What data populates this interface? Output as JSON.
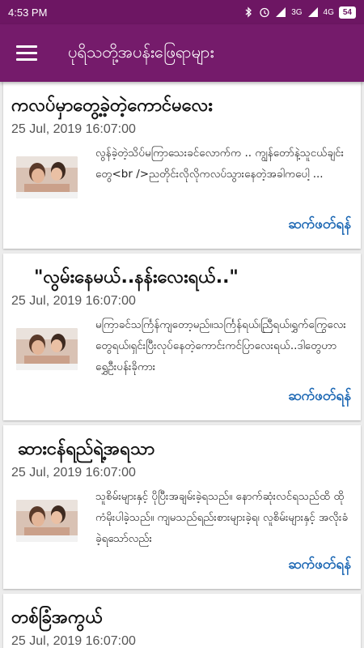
{
  "status_bar": {
    "time": "4:53 PM",
    "network_3g": "3G",
    "network_4g": "4G",
    "battery": "54"
  },
  "app_bar": {
    "title": "ပုရိသတို့အပန်းဖြေရာများ"
  },
  "articles": [
    {
      "title": "ကလပ်မှာတွေ့ခဲ့တဲ့ကောင်မလေး",
      "date": "25 Jul, 2019 16:07:00",
      "excerpt": "လွန်ခဲ့တဲ့သိပ်မကြာသေးခင်လောက်က .. ကျွန်တော်နဲ့သူငယ်ချင်းတွေ<br />ညတိုင်းလိုလိုကလပ်သွားနေတဲ့အခါကပေါ့ ...",
      "read_more": "ဆက်ဖတ်ရန်"
    },
    {
      "title": "\"လွမ်းနေမယ်..နန်းလေးရယ်..\"",
      "date": "25 Jul, 2019 16:07:00",
      "excerpt": "မကြာခင်သင်္ကြန်ကျတော့မည်။သင်္ကြန်ရယ်၊ညြီရယ်၊ရွှက်ကြွေလေးတွေရယ်၊ရှင်းပြီးလုပ်နေတဲ့ကောင်းကင်ပြာလေးရယ်..ဒါတွေဟာရွှေဦးပန်းခိုကား",
      "read_more": "ဆက်ဖတ်ရန်"
    },
    {
      "title": "ဆားငန်ရည်ရဲ့အရသာ",
      "date": "25 Jul, 2019 16:07:00",
      "excerpt": "သူစိမ်းများနှင့် ပိုပြီးအချမ်းခဲ့ရသည်။ နောက်ဆုံးလင်ရသည်ထိ ထိုကံမိုးပါခဲ့သည်။ ကျမသည်ရည်းစားများခဲ့ရ၊ လူစိမ်းများနှင့် အလိုးခံခဲ့ရသော်လည်း",
      "read_more": "ဆက်ဖတ်ရန်"
    },
    {
      "title": "တစ်ခြံအကွယ်",
      "date": "25 Jul, 2019 16:07:00",
      "excerpt": "",
      "read_more": ""
    }
  ]
}
